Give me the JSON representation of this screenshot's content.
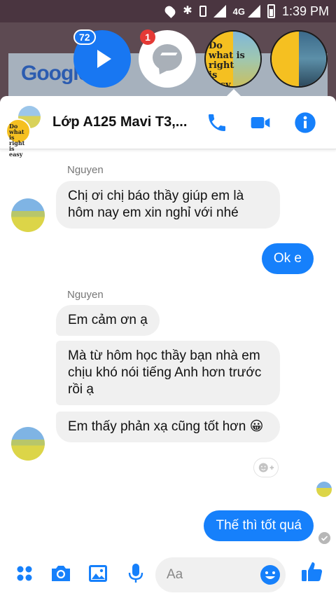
{
  "status_bar": {
    "network": "4G",
    "time": "1:39 PM"
  },
  "background": {
    "search_logo": "Google"
  },
  "chat_heads": {
    "play_badge": "72",
    "messenger_badge": "1",
    "image_text": "Do\nwhat is\nright\nis\neasy"
  },
  "header": {
    "title": "Lớp A125 Mavi T3,...",
    "group_avatar_text": "Do what is right is easy",
    "icons": [
      "phone-icon",
      "video-camera-icon",
      "info-icon"
    ]
  },
  "messages": {
    "sender_1": "Nguyen",
    "msg_1": "Chị ơi chị báo thầy giúp em là hôm nay em xin nghỉ với nhé",
    "reply_1": "Ok e",
    "sender_2": "Nguyen",
    "msg_2": "Em cảm ơn ạ",
    "msg_3": "Mà từ hôm học thầy bạn nhà em chịu khó nói tiếng Anh hơn trước rồi ạ",
    "msg_4": "Em thấy phản xạ cũng tốt hơn 😀",
    "reply_2": "Thế thì tốt quá"
  },
  "composer": {
    "placeholder": "Aa",
    "icons": [
      "apps-icon",
      "camera-icon",
      "gallery-icon",
      "microphone-icon",
      "emoji-icon",
      "thumbs-up-icon"
    ]
  },
  "colors": {
    "accent": "#1680fb",
    "incoming_bubble": "#f0f0f0",
    "badge_red": "#e53935"
  }
}
